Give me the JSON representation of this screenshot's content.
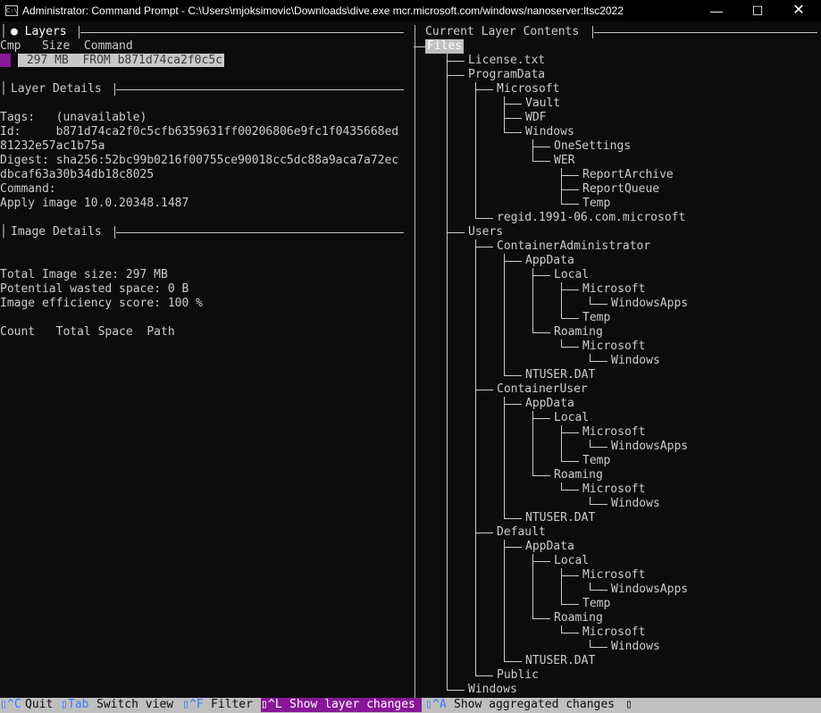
{
  "window": {
    "title": "Administrator: Command Prompt - C:\\Users\\mjoksimovic\\Downloads\\dive.exe  mcr.microsoft.com/windows/nanoserver:ltsc2022",
    "icon_text": "C:\\",
    "minimize": "—",
    "maximize": "☐",
    "close": "✕"
  },
  "layers": {
    "header": "● Layers",
    "columns": "Cmp   Size  Command",
    "rows": [
      {
        "size": "297 MB",
        "command": "FROM b871d74ca2f0c5c",
        "text": " 297 MB  FROM b871d74ca2f0c5c"
      }
    ]
  },
  "layer_details": {
    "header": "Layer Details",
    "lines": [
      "Tags:   (unavailable)",
      "Id:     b871d74ca2f0c5cfb6359631ff00206806e9fc1f0435668ed",
      "81232e57ac1b75a",
      "Digest: sha256:52bc99b0216f00755ce90018cc5dc88a9aca7a72ec",
      "dbcaf63a30b34db18c8025",
      "Command:",
      "Apply image 10.0.20348.1487"
    ]
  },
  "image_details": {
    "header": "Image Details",
    "lines": [
      "Total Image size: 297 MB",
      "Potential wasted space: 0 B",
      "Image efficiency score: 100 %"
    ],
    "table_header": "Count   Total Space  Path"
  },
  "contents": {
    "header": "Current Layer Contents",
    "files_label": "Files",
    "tree": [
      "License.txt",
      "ProgramData",
      "Microsoft",
      "Vault",
      "WDF",
      "Windows",
      "OneSettings",
      "WER",
      "ReportArchive",
      "ReportQueue",
      "Temp",
      "regid.1991-06.com.microsoft",
      "Users",
      "ContainerAdministrator",
      "AppData",
      "Local",
      "Microsoft",
      "WindowsApps",
      "Temp",
      "Roaming",
      "Microsoft",
      "Windows",
      "NTUSER.DAT",
      "ContainerUser",
      "AppData",
      "Local",
      "Microsoft",
      "WindowsApps",
      "Temp",
      "Roaming",
      "Microsoft",
      "Windows",
      "NTUSER.DAT",
      "Default",
      "AppData",
      "Local",
      "Microsoft",
      "WindowsApps",
      "Temp",
      "Roaming",
      "Microsoft",
      "Windows",
      "NTUSER.DAT",
      "Public",
      "Windows"
    ]
  },
  "statusbar": {
    "keys": [
      {
        "key": "^C",
        "label": "Quit"
      },
      {
        "key": "Tab",
        "label": "Switch view"
      },
      {
        "key": "^F",
        "label": "Filter"
      },
      {
        "key": "^L",
        "label": "Show layer changes",
        "active": true
      },
      {
        "key": "^A",
        "label": "Show aggregated changes"
      }
    ],
    "key_marker": "▯"
  },
  "colors": {
    "background": "#0c0c0c",
    "text": "#cccccc",
    "accent_purple": "#881798",
    "key_blue": "#3b78ff",
    "status_bg": "#bfbfbf"
  }
}
